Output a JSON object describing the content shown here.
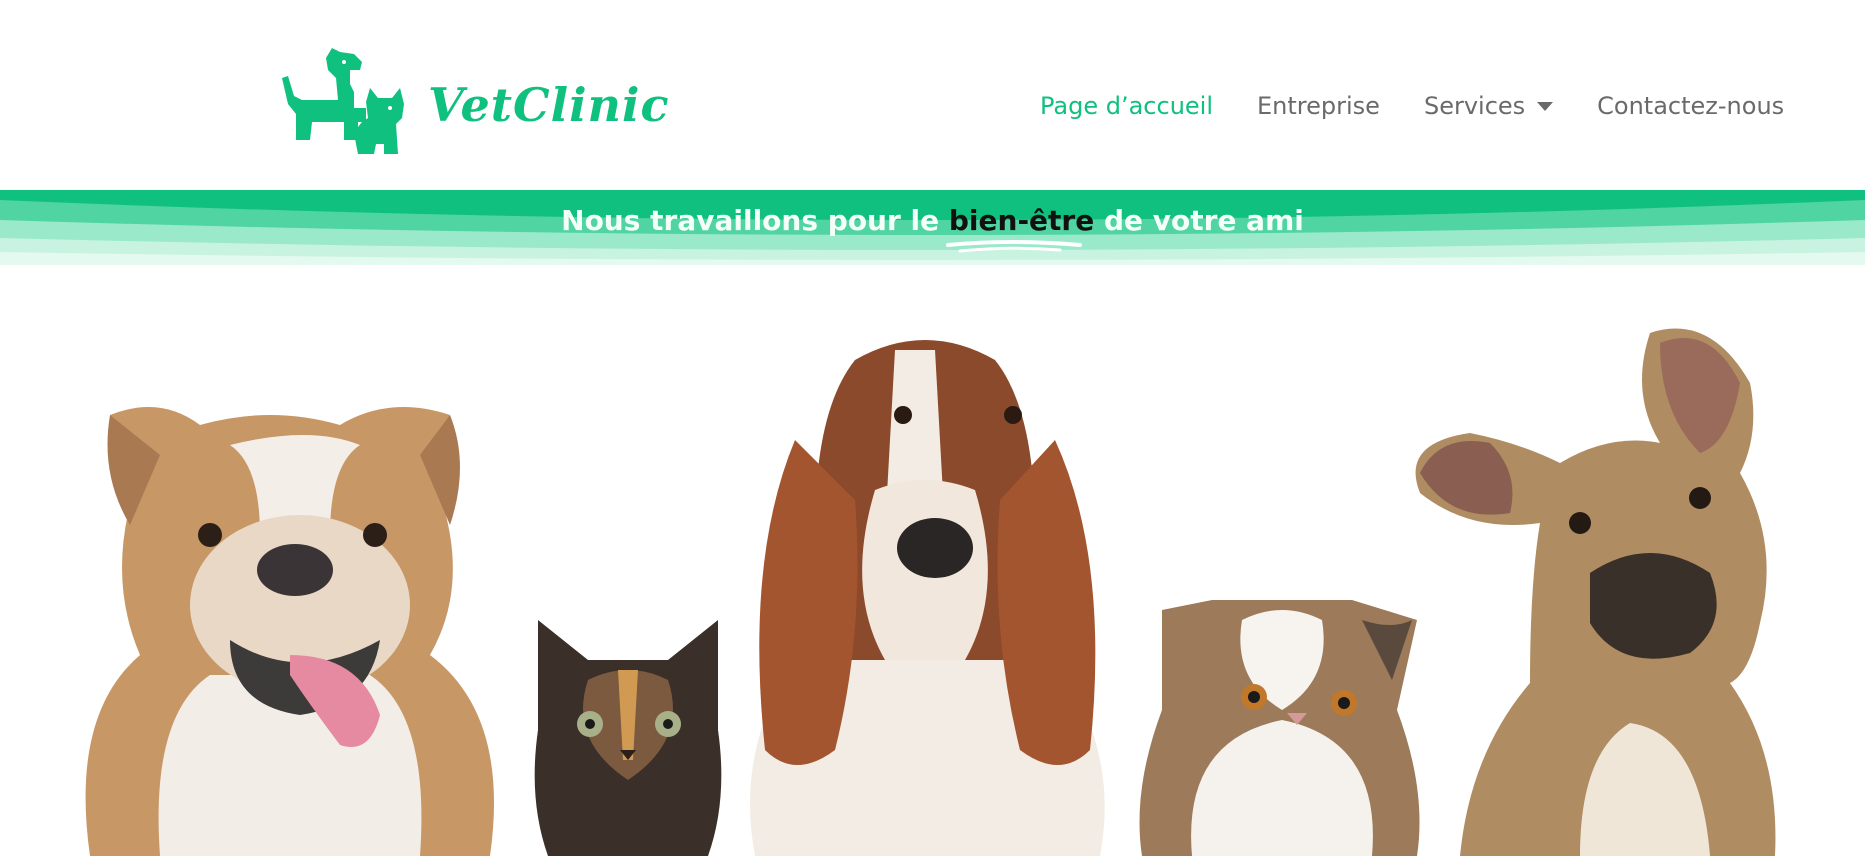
{
  "brand": {
    "name": "VetClinic",
    "color": "#10c07f"
  },
  "nav": {
    "items": [
      {
        "label": "Page d’accueil",
        "active": true
      },
      {
        "label": "Entreprise",
        "active": false
      },
      {
        "label": "Services",
        "active": false,
        "has_dropdown": true
      },
      {
        "label": "Contactez-nous",
        "active": false
      }
    ]
  },
  "banner": {
    "text_before": "Nous travaillons pour le ",
    "highlight": "bien-être",
    "text_after": " de votre ami"
  },
  "hero": {
    "animals": [
      "english-bulldog",
      "tortoiseshell-kitten",
      "basset-hound",
      "exotic-shorthair-cat",
      "french-bulldog"
    ]
  },
  "colors": {
    "accent": "#10c07f",
    "nav_text": "#6a6a6a",
    "banner_light": "#7ee3bd"
  }
}
